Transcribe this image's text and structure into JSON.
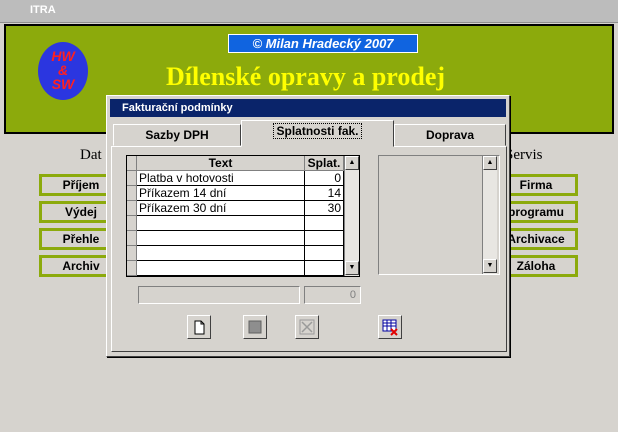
{
  "app": {
    "window_title": "ITRA"
  },
  "header": {
    "logo_text": [
      "HW",
      "&",
      "SW"
    ],
    "copyright": "©  Milan Hradecký  2007",
    "title": "Dílenské opravy a prodej"
  },
  "sections": {
    "left": "Dat",
    "right": "Servis"
  },
  "menu_left": [
    "Příjem",
    "Výdej",
    "Přehle",
    "Archiv"
  ],
  "menu_right": [
    "Firma",
    "programu",
    "Archivace",
    "Záloha"
  ],
  "dialog": {
    "title": "Fakturační podmínky",
    "tabs": [
      "Sazby DPH",
      "Splatnosti fak.",
      "Doprava"
    ],
    "active_tab": 1,
    "grid": {
      "columns": [
        "Text",
        "Splat."
      ],
      "rows": [
        {
          "text": "Platba v hotovosti",
          "value": "0"
        },
        {
          "text": "Příkazem 14 dní",
          "value": "14"
        },
        {
          "text": "Příkazem 30 dní",
          "value": "30"
        },
        {
          "text": "",
          "value": ""
        },
        {
          "text": "",
          "value": ""
        },
        {
          "text": "",
          "value": ""
        },
        {
          "text": "",
          "value": ""
        }
      ]
    },
    "text_field": "",
    "value_field": "0",
    "toolbar": [
      "new-record-icon",
      "save-icon",
      "delete-icon",
      "grid-close-icon"
    ]
  },
  "colors": {
    "header_green": "#8caa0c",
    "title_yellow": "#ffff00",
    "dialog_title": "#0a246a"
  }
}
